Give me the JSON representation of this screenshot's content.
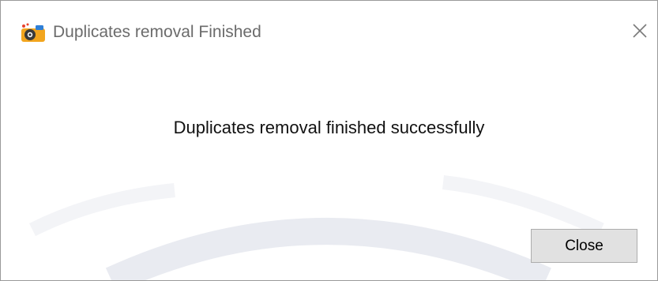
{
  "window": {
    "title": "Duplicates removal Finished",
    "app_icon": "camera-app-icon",
    "close_icon": "close-icon"
  },
  "content": {
    "message": "Duplicates removal finished successfully"
  },
  "buttons": {
    "close_label": "Close"
  },
  "colors": {
    "title_text": "#6b6b6b",
    "button_face": "#e1e1e1",
    "button_border": "#adadad",
    "watermark": "#eceef3"
  }
}
